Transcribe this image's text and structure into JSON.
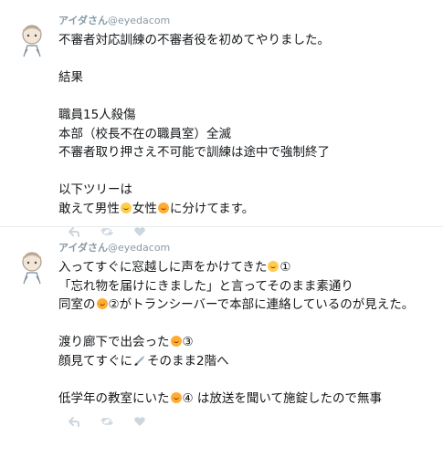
{
  "tweets": [
    {
      "name": "アイダさん",
      "handle": "@eyedacom",
      "lines": [
        "不審者対応訓練の不審者役を初めてやりました。",
        "",
        "結果",
        "",
        "職員15人殺傷",
        "本部（校長不在の職員室）全滅",
        "不審者取り押さえ不可能で訓練は途中で強制終了",
        "",
        "以下ツリーは",
        "敢えて男性",
        "女性",
        "に分けてます。"
      ]
    },
    {
      "name": "アイダさん",
      "handle": "@eyedacom",
      "lines": [
        "入ってすぐに窓越しに声をかけてきた",
        "①",
        "「忘れ物を届けにきました」と言ってそのまま素通り",
        "同室の",
        "②がトランシーバーで本部に連絡しているのが見えた。",
        "",
        "渡り廊下で出会った",
        "③",
        "顔見てすぐに",
        "そのまま2階へ",
        "",
        "低学年の教室にいた",
        "④ は放送を聞いて施錠したので無事"
      ]
    }
  ],
  "icons": {
    "reply": "reply-icon",
    "retweet": "retweet-icon",
    "like": "heart-icon",
    "man": "man-emoji-icon",
    "woman": "woman-emoji-icon",
    "knife": "knife-emoji-icon"
  },
  "colors": {
    "text": "#14171a",
    "muted": "#8899a6",
    "divider": "#e6ecf0",
    "icon": "#ccd6dd"
  }
}
